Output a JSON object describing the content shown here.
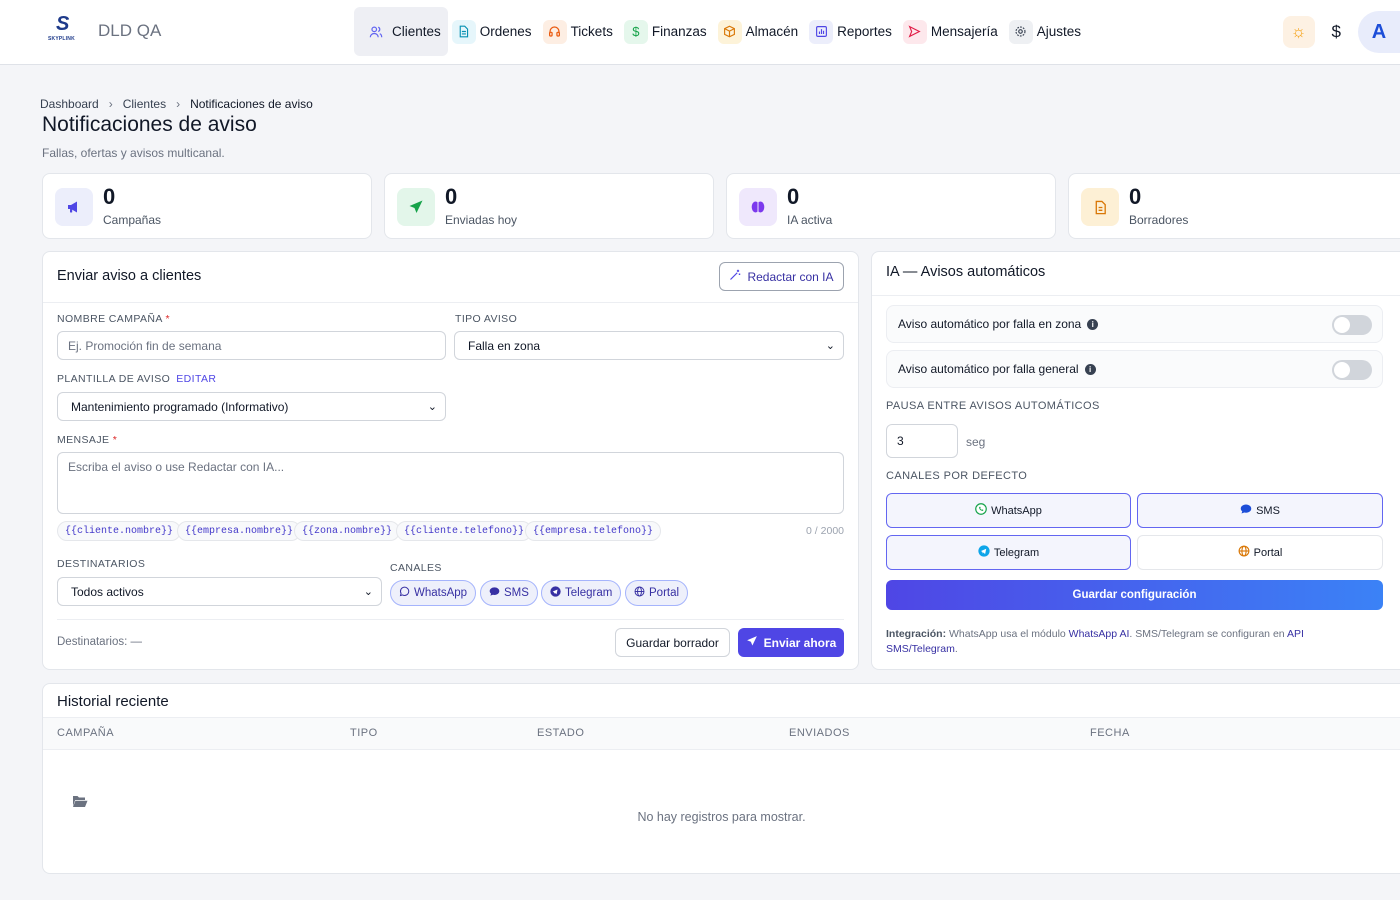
{
  "app": {
    "name": "DLD QA",
    "logo_text": "S",
    "logo_sub": "SKYPLINK"
  },
  "nav": [
    {
      "label": "Clientes",
      "icon": "users-icon",
      "active": true
    },
    {
      "label": "Ordenes",
      "icon": "document-icon"
    },
    {
      "label": "Tickets",
      "icon": "headset-icon"
    },
    {
      "label": "Finanzas",
      "icon": "dollar-icon"
    },
    {
      "label": "Almacén",
      "icon": "box-icon"
    },
    {
      "label": "Reportes",
      "icon": "chart-icon"
    },
    {
      "label": "Mensajería",
      "icon": "send-icon"
    },
    {
      "label": "Ajustes",
      "icon": "gear-icon"
    }
  ],
  "user": {
    "initial": "A"
  },
  "breadcrumb": [
    "Dashboard",
    "Clientes",
    "Notificaciones de aviso"
  ],
  "page": {
    "title": "Notificaciones de aviso",
    "subtitle": "Fallas, ofertas y avisos multicanal."
  },
  "stats": [
    {
      "value": "0",
      "label": "Campañas",
      "icon": "megaphone-icon",
      "color": "#4f46e5"
    },
    {
      "value": "0",
      "label": "Enviadas hoy",
      "icon": "send-icon",
      "color": "#16a34a"
    },
    {
      "value": "0",
      "label": "IA activa",
      "icon": "brain-icon",
      "color": "#7c3aed"
    },
    {
      "value": "0",
      "label": "Borradores",
      "icon": "file-icon",
      "color": "#d97706"
    }
  ],
  "send_form": {
    "title": "Enviar aviso a clientes",
    "ai_button": "Redactar con IA",
    "campaign_label": "NOMBRE CAMPAÑA",
    "campaign_placeholder": "Ej. Promoción fin de semana",
    "type_label": "TIPO AVISO",
    "type_value": "Falla en zona",
    "template_label": "PLANTILLA DE AVISO",
    "template_edit": "EDITAR",
    "template_value": "Mantenimiento programado (Informativo)",
    "message_label": "MENSAJE",
    "message_placeholder": "Escriba el aviso o use Redactar con IA...",
    "tokens": [
      "{{cliente.nombre}}",
      "{{empresa.nombre}}",
      "{{zona.nombre}}",
      "{{cliente.telefono}}",
      "{{empresa.telefono}}"
    ],
    "counter": "0 / 2000",
    "recipients_label": "DESTINATARIOS",
    "recipients_value": "Todos activos",
    "channels_label": "CANALES",
    "channels": [
      "WhatsApp",
      "SMS",
      "Telegram",
      "Portal"
    ],
    "recipients_count": "Destinatarios: —",
    "save_draft": "Guardar borrador",
    "send_now": "Enviar ahora"
  },
  "ai_panel": {
    "title": "IA — Avisos automáticos",
    "toggle_zone": "Aviso automático por falla en zona",
    "toggle_general": "Aviso automático por falla general",
    "pause_label": "PAUSA ENTRE AVISOS AUTOMÁTICOS",
    "pause_value": "3",
    "pause_unit": "seg",
    "default_channels_label": "CANALES POR DEFECTO",
    "channels": [
      {
        "label": "WhatsApp",
        "selected": true
      },
      {
        "label": "SMS",
        "selected": true
      },
      {
        "label": "Telegram",
        "selected": true
      },
      {
        "label": "Portal",
        "selected": false
      }
    ],
    "save_button": "Guardar configuración",
    "integration_label": "Integración:",
    "integration_text_1": "WhatsApp usa el módulo",
    "integration_link_1": "WhatsApp AI",
    "integration_text_2": ". SMS/Telegram se configuran en",
    "integration_link_2": "API SMS/Telegram",
    "integration_text_3": "."
  },
  "history": {
    "title": "Historial reciente",
    "columns": [
      "CAMPAÑA",
      "TIPO",
      "ESTADO",
      "ENVIADOS",
      "FECHA"
    ],
    "empty": "No hay registros para mostrar."
  }
}
